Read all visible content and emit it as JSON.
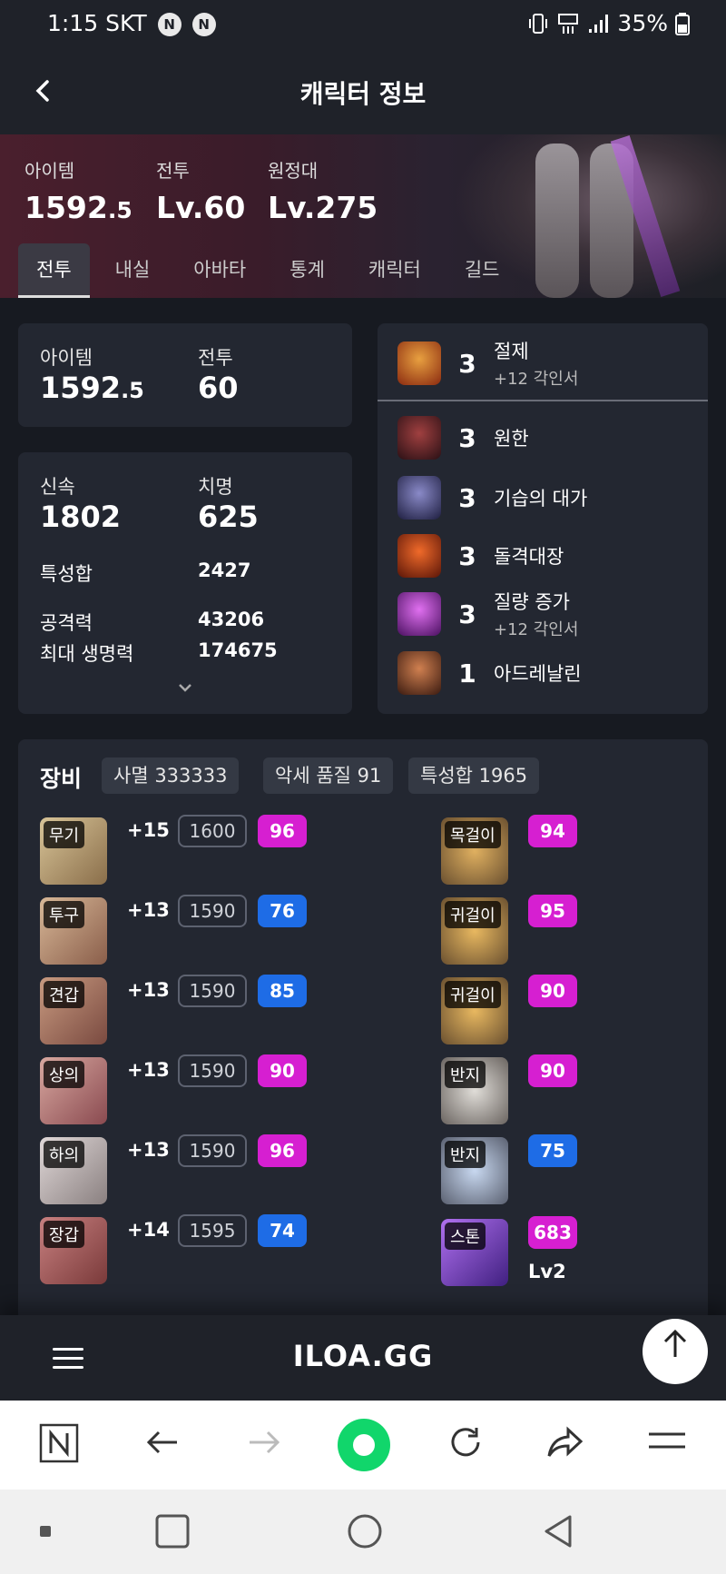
{
  "status_bar": {
    "time": "1:15",
    "carrier": "SKT",
    "badges": [
      "N",
      "N"
    ],
    "battery": "35%"
  },
  "header": {
    "title": "캐릭터 정보",
    "back_icon": "chevron-left-icon"
  },
  "hero": {
    "stats": [
      {
        "label": "아이템",
        "value": "1592",
        "value_small": ".5"
      },
      {
        "label": "전투",
        "value": "Lv.60",
        "value_small": ""
      },
      {
        "label": "원정대",
        "value": "Lv.275",
        "value_small": ""
      }
    ]
  },
  "tabs": [
    "전투",
    "내실",
    "아바타",
    "통계",
    "캐릭터",
    "길드"
  ],
  "summary": {
    "item_label": "아이템",
    "item_value": "1592",
    "item_small": ".5",
    "combat_label": "전투",
    "combat_value": "60"
  },
  "stats": {
    "swift_label": "신속",
    "swift_value": "1802",
    "crit_label": "치명",
    "crit_value": "625",
    "rows": [
      {
        "label": "특성합",
        "value": "2427"
      },
      {
        "label": "공격력",
        "value": "43206"
      },
      {
        "label": "최대 생명력",
        "value": "174675"
      }
    ]
  },
  "engravings": [
    {
      "count": "3",
      "name": "절제",
      "sub": "+12 각인서",
      "icon_color": "#c0552a"
    },
    {
      "count": "3",
      "name": "원한",
      "sub": "",
      "icon_color": "#7a2c30"
    },
    {
      "count": "3",
      "name": "기습의 대가",
      "sub": "",
      "icon_color": "#3a3a6a"
    },
    {
      "count": "3",
      "name": "돌격대장",
      "sub": "",
      "icon_color": "#b2421e"
    },
    {
      "count": "3",
      "name": "질량 증가",
      "sub": "+12 각인서",
      "icon_color": "#a93ac0"
    },
    {
      "count": "1",
      "name": "아드레날린",
      "sub": "",
      "icon_color": "#8a4a32"
    }
  ],
  "equipment": {
    "title": "장비",
    "pills": [
      "사멸 333333",
      "악세 품질 91",
      "특성합 1965"
    ],
    "gear": [
      {
        "tag": "무기",
        "plus": "+15",
        "level": "1600",
        "quality": "96",
        "q_color": "#d61fd1",
        "icon_color": "#c9b08a"
      },
      {
        "tag": "투구",
        "plus": "+13",
        "level": "1590",
        "quality": "76",
        "q_color": "#1e6ce6",
        "icon_color": "#c9a684"
      },
      {
        "tag": "견갑",
        "plus": "+13",
        "level": "1590",
        "quality": "85",
        "q_color": "#1e6ce6",
        "icon_color": "#b98a72"
      },
      {
        "tag": "상의",
        "plus": "+13",
        "level": "1590",
        "quality": "90",
        "q_color": "#d61fd1",
        "icon_color": "#c68a86"
      },
      {
        "tag": "하의",
        "plus": "+13",
        "level": "1590",
        "quality": "96",
        "q_color": "#d61fd1",
        "icon_color": "#c9c0c0"
      },
      {
        "tag": "장갑",
        "plus": "+14",
        "level": "1595",
        "quality": "74",
        "q_color": "#1e6ce6",
        "icon_color": "#b47070"
      }
    ],
    "accessories": [
      {
        "tag": "목걸이",
        "quality": "94",
        "q_color": "#d61fd1",
        "extra": "",
        "icon_color": "#b89466"
      },
      {
        "tag": "귀걸이",
        "quality": "95",
        "q_color": "#d61fd1",
        "extra": "",
        "icon_color": "#b89466"
      },
      {
        "tag": "귀걸이",
        "quality": "90",
        "q_color": "#d61fd1",
        "extra": "",
        "icon_color": "#b89466"
      },
      {
        "tag": "반지",
        "quality": "90",
        "q_color": "#d61fd1",
        "extra": "",
        "icon_color": "#9e9890"
      },
      {
        "tag": "반지",
        "quality": "75",
        "q_color": "#1e6ce6",
        "extra": "",
        "icon_color": "#8e9aa8"
      },
      {
        "tag": "스톤",
        "quality": "683",
        "q_color": "#d61fd1",
        "extra": "Lv2",
        "icon_color": "#7a4fc4"
      }
    ]
  },
  "footer": {
    "logo": "ILOA.GG"
  }
}
